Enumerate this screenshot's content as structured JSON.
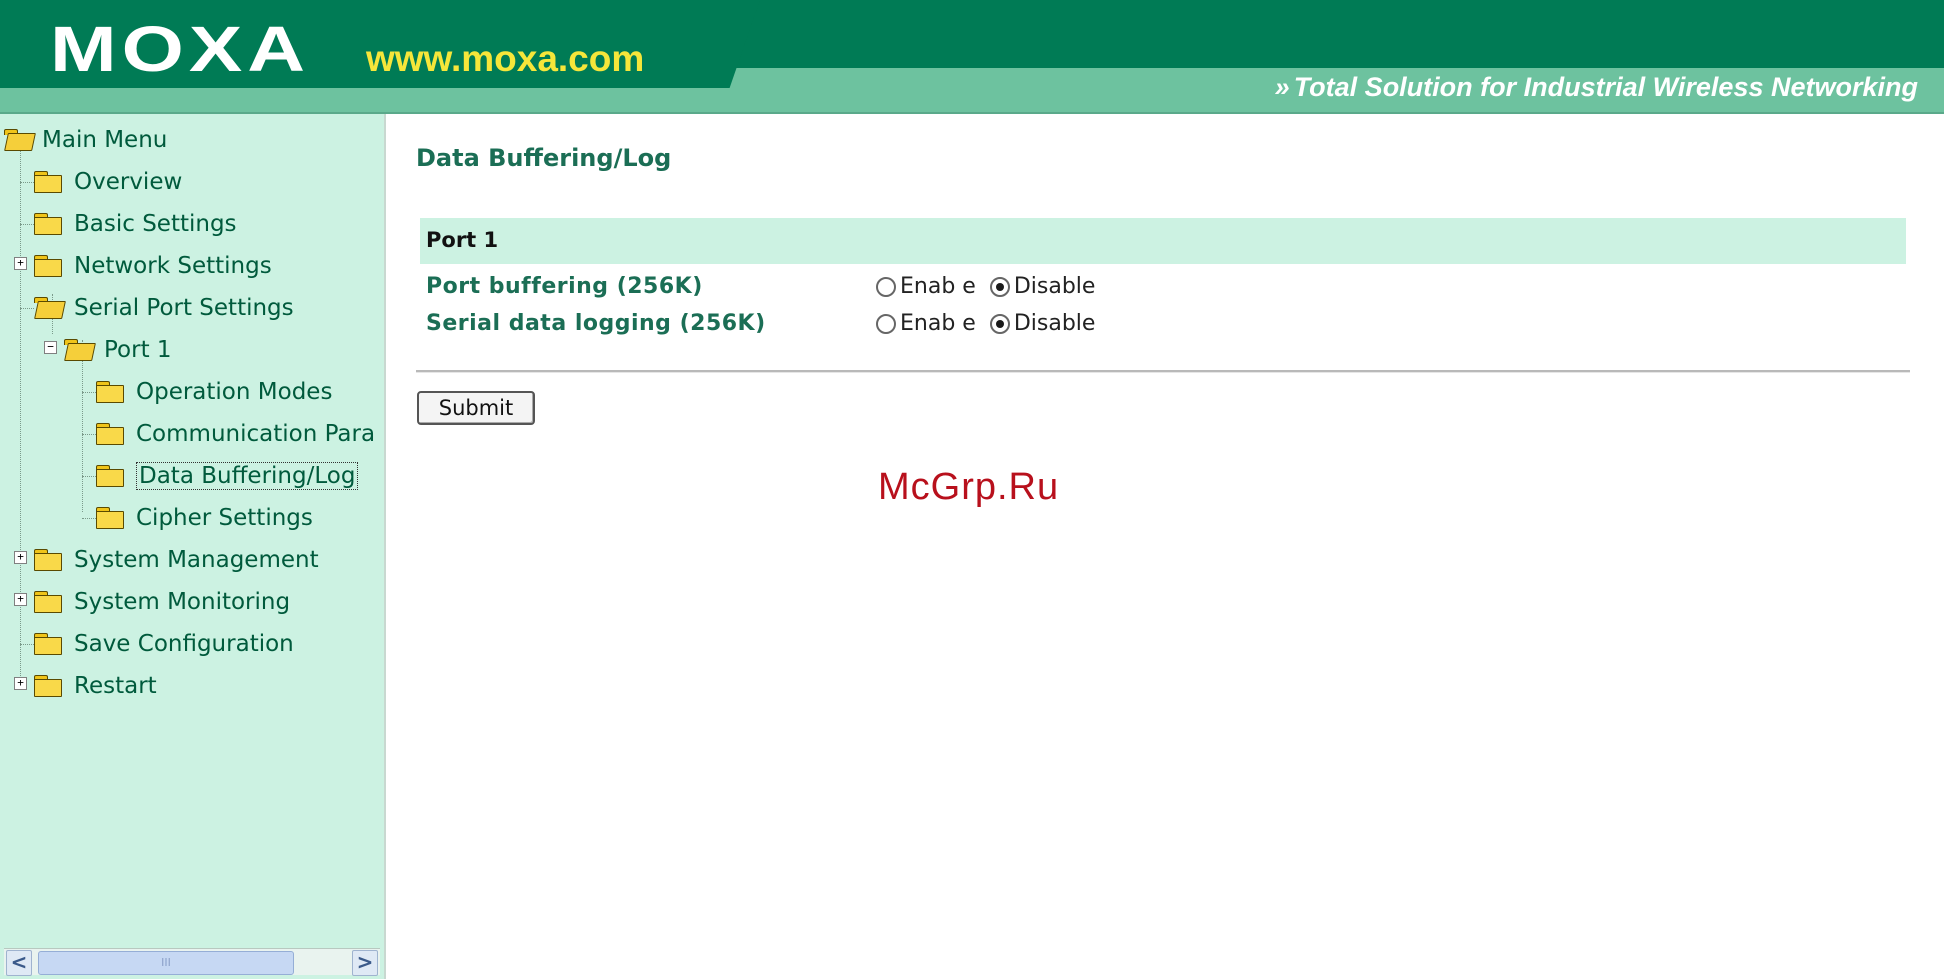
{
  "header": {
    "logo": "MOXA",
    "url": "www.moxa.com",
    "tagline_arrows": "»",
    "tagline": "Total Solution for Industrial Wireless Networking",
    "colors": {
      "band_dark": "#007b55",
      "band_light": "#6dc29f",
      "url_yellow": "#f6e63a"
    }
  },
  "sidebar": {
    "root": "Main Menu",
    "items": [
      {
        "label": "Overview",
        "icon": "folder-icon"
      },
      {
        "label": "Basic Settings",
        "icon": "folder-icon"
      },
      {
        "label": "Network Settings",
        "icon": "folder-icon",
        "expander": "+"
      },
      {
        "label": "Serial Port Settings",
        "icon": "folder-open-icon"
      },
      {
        "label": "Port 1",
        "icon": "folder-open-icon",
        "expander": "−"
      },
      {
        "label": "Operation Modes",
        "icon": "folder-icon"
      },
      {
        "label": "Communication Para",
        "icon": "folder-icon"
      },
      {
        "label": "Data Buffering/Log",
        "icon": "folder-icon",
        "selected": true
      },
      {
        "label": "Cipher Settings",
        "icon": "folder-icon"
      },
      {
        "label": "System Management",
        "icon": "folder-icon",
        "expander": "+"
      },
      {
        "label": "System Monitoring",
        "icon": "folder-icon",
        "expander": "+"
      },
      {
        "label": "Save Configuration",
        "icon": "folder-icon"
      },
      {
        "label": "Restart",
        "icon": "folder-icon",
        "expander": "+"
      }
    ],
    "scrollbar": {
      "left_arrow": "<",
      "right_arrow": ">",
      "grip": "III"
    }
  },
  "main": {
    "title": "Data Buffering/Log",
    "section": "Port 1",
    "settings": [
      {
        "label": "Port buffering (256K)",
        "options": [
          "Enab e",
          "Disable"
        ],
        "selected": "Disable"
      },
      {
        "label": "Serial data logging (256K)",
        "options": [
          "Enab e",
          "Disable"
        ],
        "selected": "Disable"
      }
    ],
    "submit_label": "Submit",
    "watermark": "McGrp.Ru"
  }
}
